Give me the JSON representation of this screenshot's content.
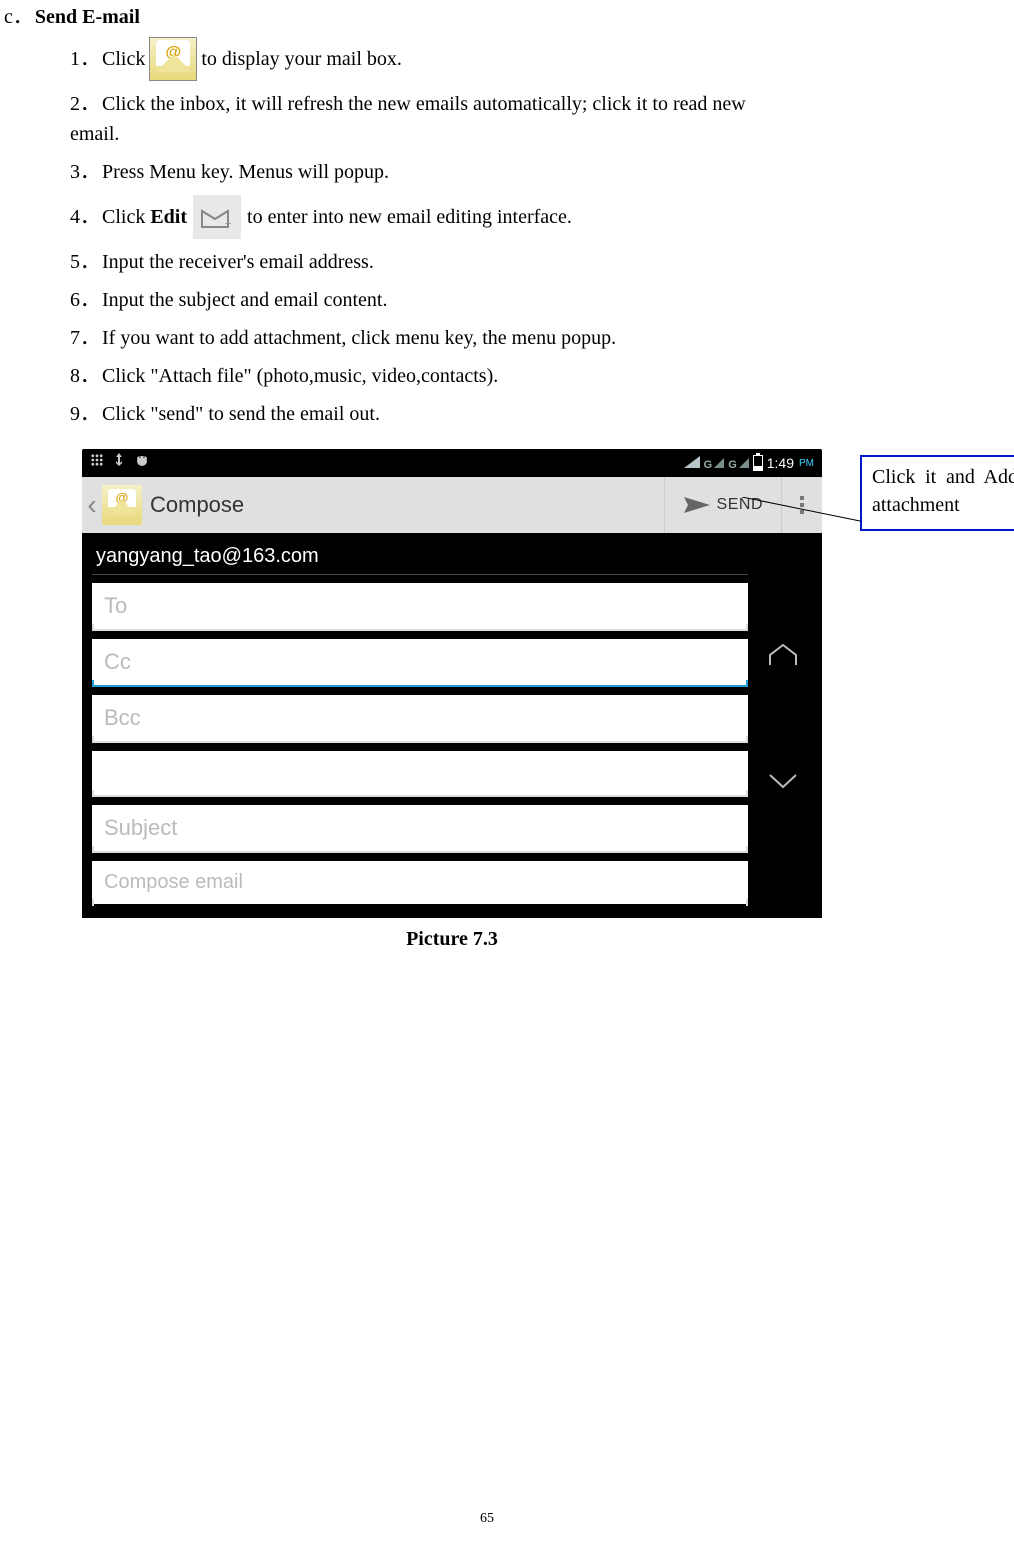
{
  "heading": {
    "letter": "c．",
    "title": "Send E-mail"
  },
  "steps": {
    "s1": {
      "num": "1．",
      "before": "Click",
      "after": "to display your mail box."
    },
    "s2": {
      "num": "2．",
      "text": "Click the inbox, it will refresh the new emails automatically; click it to read new",
      "cont": "email."
    },
    "s3": {
      "num": "3．",
      "text": "Press Menu key. Menus will popup."
    },
    "s4": {
      "num": "4．",
      "before": "Click",
      "bold": "Edit",
      "after": "to enter into new email editing interface."
    },
    "s5": {
      "num": "5．",
      "text": "Input the receiver's email address."
    },
    "s6": {
      "num": "6．",
      "text": "Input the subject and email content."
    },
    "s7": {
      "num": "7．",
      "text": "If you want to add attachment, click menu key, the menu popup."
    },
    "s8": {
      "num": "8．",
      "text": "Click \"Attach file\" (photo,music, video,contacts)."
    },
    "s9": {
      "num": "9．",
      "text": "Click \"send\" to send the email out."
    }
  },
  "screenshot": {
    "statusbar": {
      "time": "1:49",
      "pm": "PM"
    },
    "appbar": {
      "title": "Compose",
      "send": "SEND"
    },
    "from": "yangyang_tao@163.com",
    "to": "To",
    "cc": "Cc",
    "bcc": "Bcc",
    "subject": "Subject",
    "body": "Compose email"
  },
  "callout": "Click it and Add attachment",
  "caption": "Picture 7.3",
  "pageNumber": "65"
}
